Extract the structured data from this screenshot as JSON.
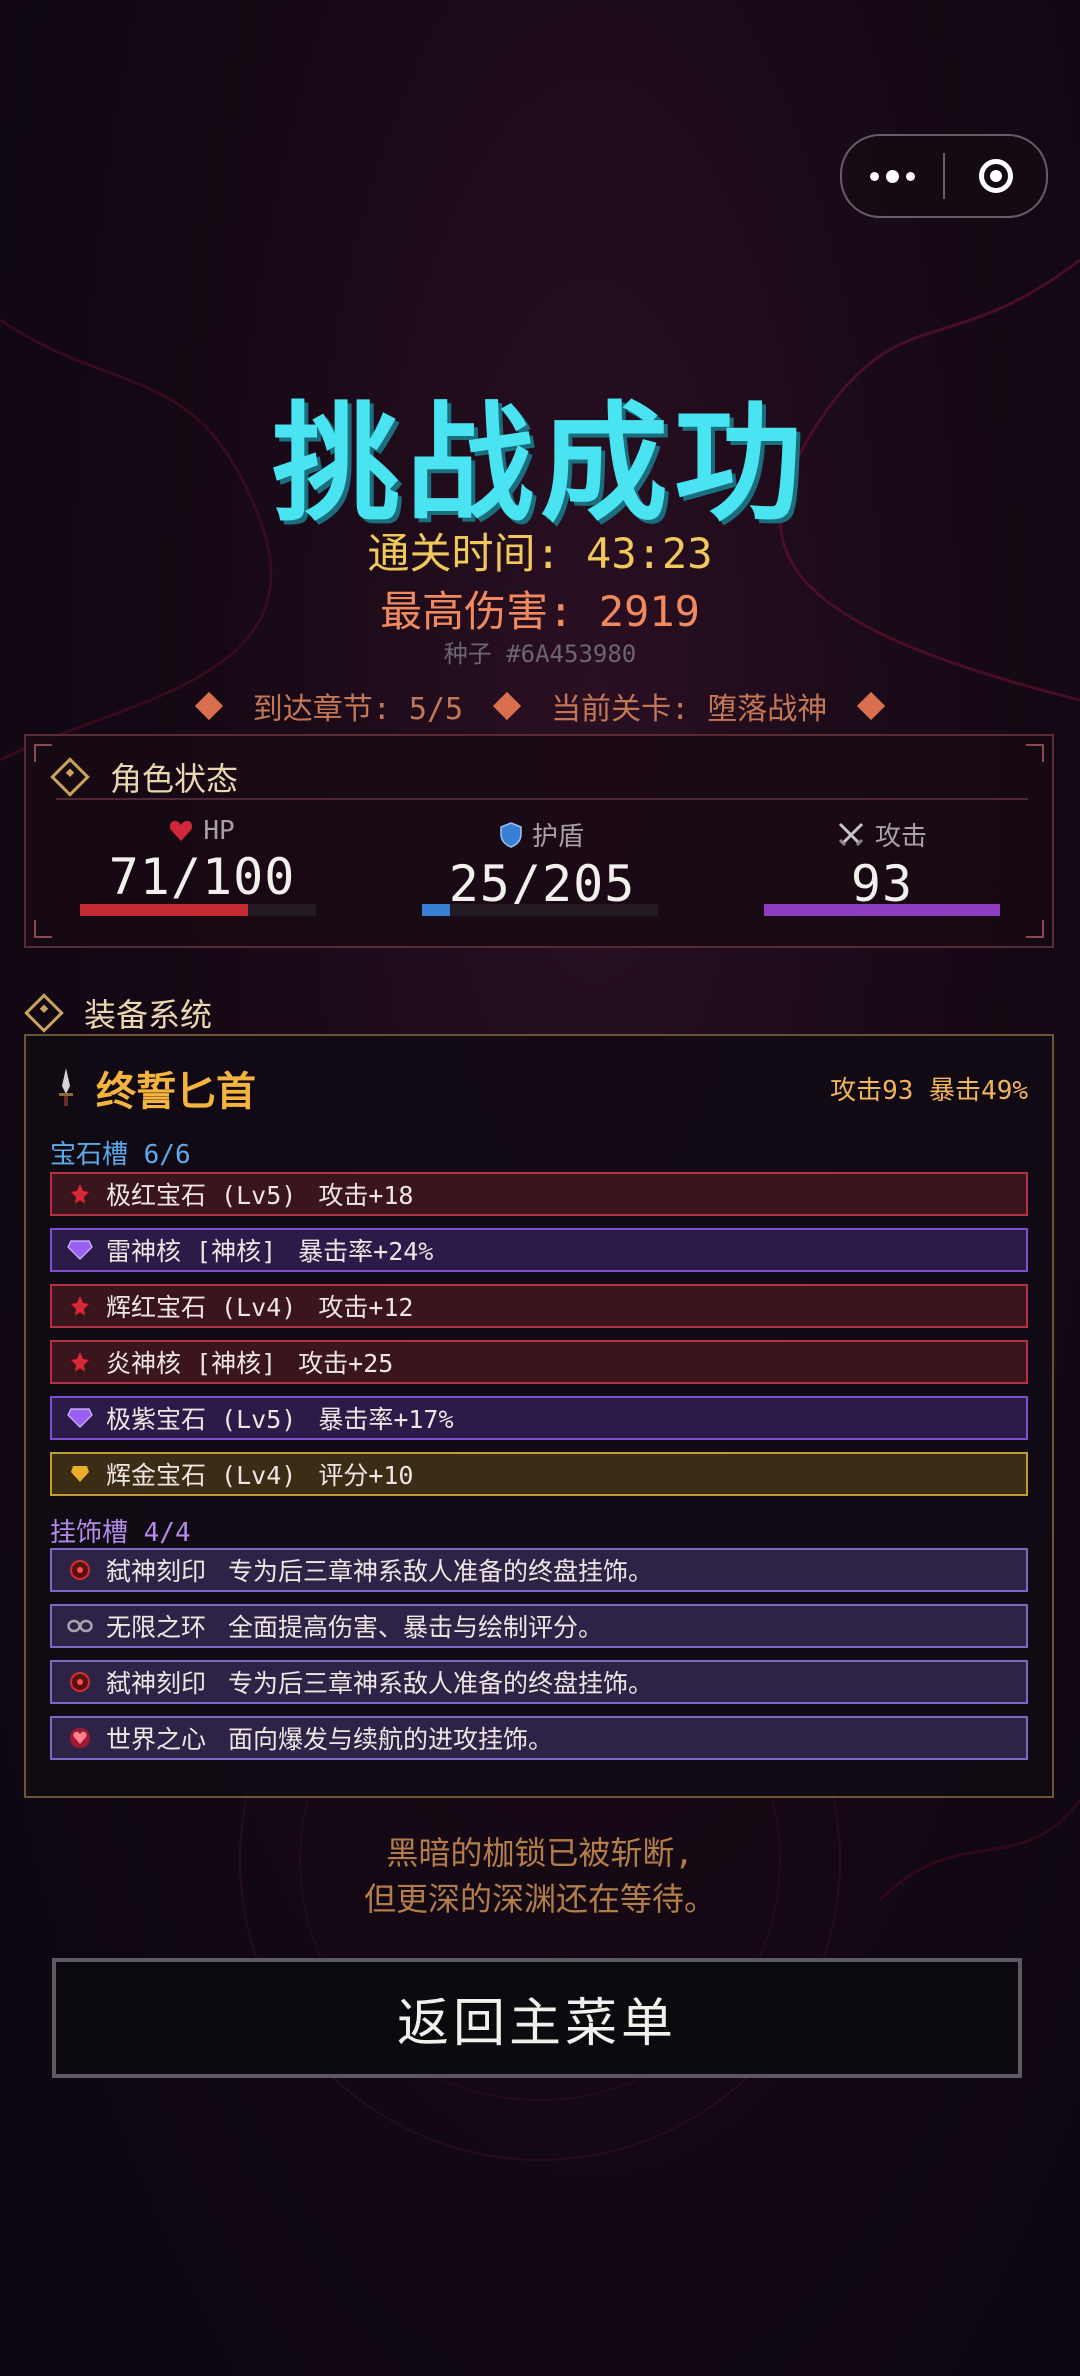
{
  "result": {
    "title": "挑战成功",
    "clear_time": "通关时间: 43:23",
    "max_damage": "最高伤害: 2919",
    "seed": "种子 #6A453980",
    "chapter": "到达章节: 5/5",
    "stage": "当前关卡: 堕落战神"
  },
  "status": {
    "heading": "角色状态",
    "hp": {
      "label": "HP",
      "value": "71/100",
      "fraction": 0.71
    },
    "shield": {
      "label": "护盾",
      "value": "25/205",
      "fraction": 0.12
    },
    "attack": {
      "label": "攻击",
      "value": "93",
      "fraction": 1.0
    }
  },
  "equipment": {
    "heading": "装备系统",
    "weapon": {
      "name": "终誓匕首",
      "stats": "攻击93 暴击49%"
    },
    "gem_section": "宝石槽 6/6",
    "gems": [
      {
        "name": "极红宝石 (Lv5)",
        "effect": "攻击+18",
        "type": "red"
      },
      {
        "name": "雷神核 [神核]",
        "effect": "暴击率+24%",
        "type": "purple"
      },
      {
        "name": "辉红宝石 (Lv4)",
        "effect": "攻击+12",
        "type": "red"
      },
      {
        "name": "炎神核 [神核]",
        "effect": "攻击+25",
        "type": "red"
      },
      {
        "name": "极紫宝石 (Lv5)",
        "effect": "暴击率+17%",
        "type": "purple"
      },
      {
        "name": "辉金宝石 (Lv4)",
        "effect": "评分+10",
        "type": "gold"
      }
    ],
    "accessory_section": "挂饰槽 4/4",
    "accessories": [
      {
        "name": "弑神刻印",
        "desc": "专为后三章神系敌人准备的终盘挂饰。",
        "icon": "sigil-icon"
      },
      {
        "name": "无限之环",
        "desc": "全面提高伤害、暴击与绘制评分。",
        "icon": "infinity-ring-icon"
      },
      {
        "name": "弑神刻印",
        "desc": "专为后三章神系敌人准备的终盘挂饰。",
        "icon": "sigil-icon"
      },
      {
        "name": "世界之心",
        "desc": "面向爆发与续航的进攻挂饰。",
        "icon": "heart-gem-icon"
      }
    ]
  },
  "flavor": {
    "line1": "黑暗的枷锁已被斩断,",
    "line2": "但更深的深渊还在等待。"
  },
  "return_button": "返回主菜单",
  "colors": {
    "title": "#4ae3f2",
    "hp_bar": "#c42a30",
    "shield_bar": "#3a7fd6",
    "attack_bar": "#8e3cc0"
  }
}
